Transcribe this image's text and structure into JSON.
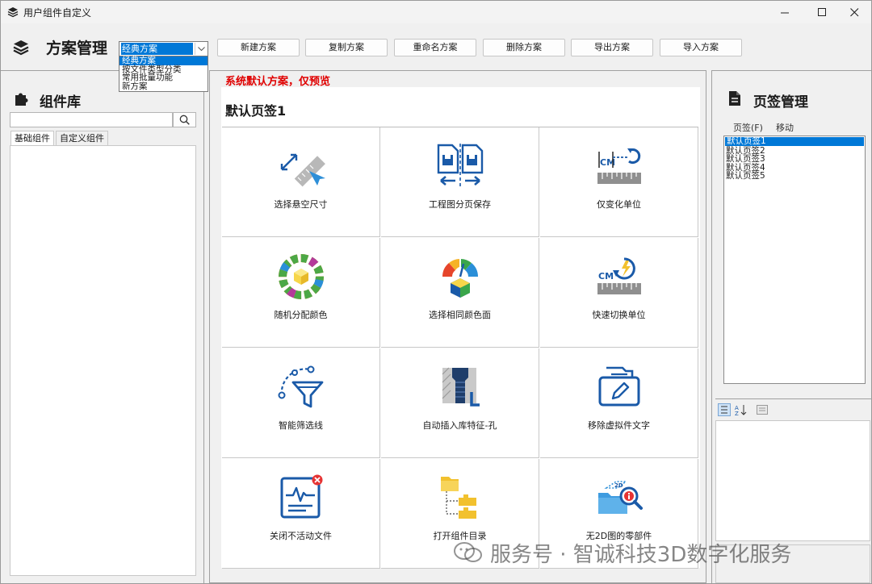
{
  "window": {
    "title": "用户组件自定义"
  },
  "toolbar": {
    "scheme_title": "方案管理",
    "selected_scheme": "经典方案",
    "scheme_options": [
      "经典方案",
      "按文件类型分类",
      "常用批量功能",
      "新方案"
    ],
    "buttons": [
      "新建方案",
      "复制方案",
      "重命名方案",
      "删除方案",
      "导出方案",
      "导入方案"
    ]
  },
  "library": {
    "title": "组件库",
    "search_value": "",
    "tabs": [
      "基础组件",
      "自定义组件"
    ]
  },
  "center": {
    "warning": "系统默认方案，仅预览",
    "warning_color": "#e00000",
    "page_title": "默认页签1",
    "components": [
      {
        "label": "选择悬空尺寸",
        "icon": "measure-ruler-icon"
      },
      {
        "label": "工程图分页保存",
        "icon": "split-save-icon"
      },
      {
        "label": "仅变化单位",
        "icon": "unit-change-icon"
      },
      {
        "label": "随机分配颜色",
        "icon": "color-wheel-icon"
      },
      {
        "label": "选择相同颜色面",
        "icon": "color-face-icon"
      },
      {
        "label": "快速切换单位",
        "icon": "unit-switch-icon"
      },
      {
        "label": "智能筛选线",
        "icon": "filter-curve-icon"
      },
      {
        "label": "自动插入库特征-孔",
        "icon": "hole-feature-icon"
      },
      {
        "label": "移除虚拟件文字",
        "icon": "remove-text-icon"
      },
      {
        "label": "关闭不活动文件",
        "icon": "close-inactive-icon"
      },
      {
        "label": "打开组件目录",
        "icon": "folder-tree-icon"
      },
      {
        "label": "无2D图的零部件",
        "icon": "no-2d-part-icon"
      }
    ]
  },
  "tabs_panel": {
    "title": "页签管理",
    "menu": [
      "页签(F)",
      "移动"
    ],
    "items": [
      "默认页签1",
      "默认页签2",
      "默认页签3",
      "默认页签4",
      "默认页签5"
    ],
    "selected_index": 0
  },
  "watermark": {
    "text": "服务号 · 智诚科技3D数字化服务"
  },
  "colors": {
    "accent": "#0078d7",
    "icon_blue": "#1a5aa8",
    "icon_yellow": "#f2c12e"
  }
}
